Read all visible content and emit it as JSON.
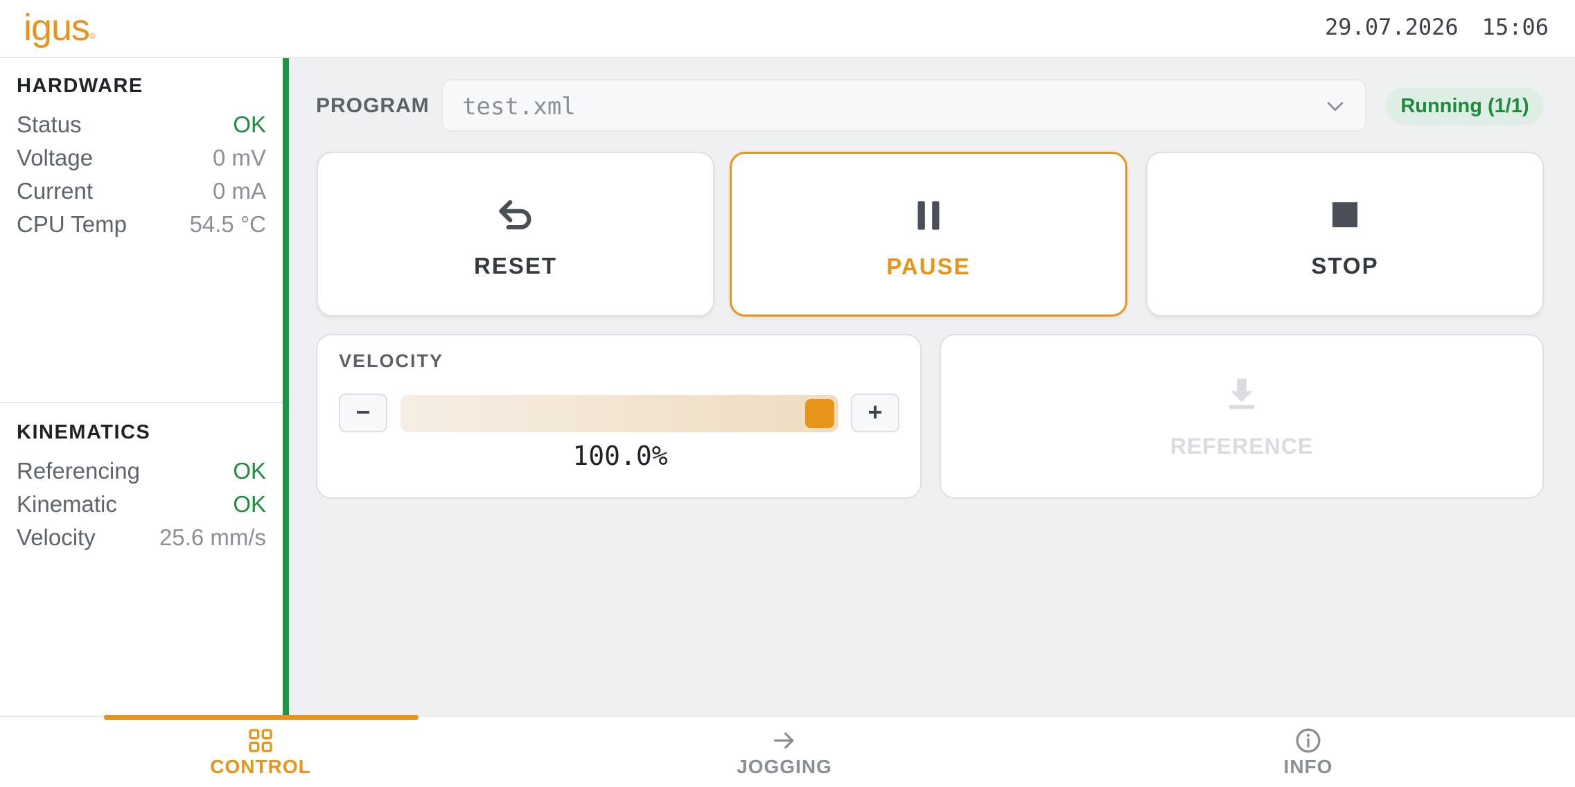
{
  "header": {
    "logo": "igus",
    "date": "29.07.2026",
    "time": "15:06"
  },
  "sidebar": {
    "hardware": {
      "title": "HARDWARE",
      "rows": [
        {
          "label": "Status",
          "value": "OK"
        },
        {
          "label": "Voltage",
          "value": "0 mV"
        },
        {
          "label": "Current",
          "value": "0 mA"
        },
        {
          "label": "CPU Temp",
          "value": "54.5 °C"
        }
      ]
    },
    "kinematics": {
      "title": "KINEMATICS",
      "rows": [
        {
          "label": "Referencing",
          "value": "OK"
        },
        {
          "label": "Kinematic",
          "value": "OK"
        },
        {
          "label": "Velocity",
          "value": "25.6 mm/s"
        }
      ]
    }
  },
  "program": {
    "label": "PROGRAM",
    "selected": "test.xml",
    "status": "Running (1/1)"
  },
  "actions": {
    "reset": "RESET",
    "pause": "PAUSE",
    "stop": "STOP",
    "reference": "REFERENCE"
  },
  "velocity": {
    "title": "VELOCITY",
    "minus": "−",
    "plus": "+",
    "percent": 100.0,
    "display": "100.0%"
  },
  "nav": {
    "control": "CONTROL",
    "jogging": "JOGGING",
    "info": "INFO"
  },
  "colors": {
    "accent": "#e8931a",
    "ok": "#1e8a3c",
    "sidebar_accent": "#1e9445"
  },
  "icons": {
    "reset": "undo-arrow-icon",
    "pause": "pause-icon",
    "stop": "stop-icon",
    "reference": "download-icon",
    "control": "grid-icon",
    "jogging": "arrow-right-icon",
    "info": "info-icon",
    "dropdown": "chevron-down-icon"
  }
}
